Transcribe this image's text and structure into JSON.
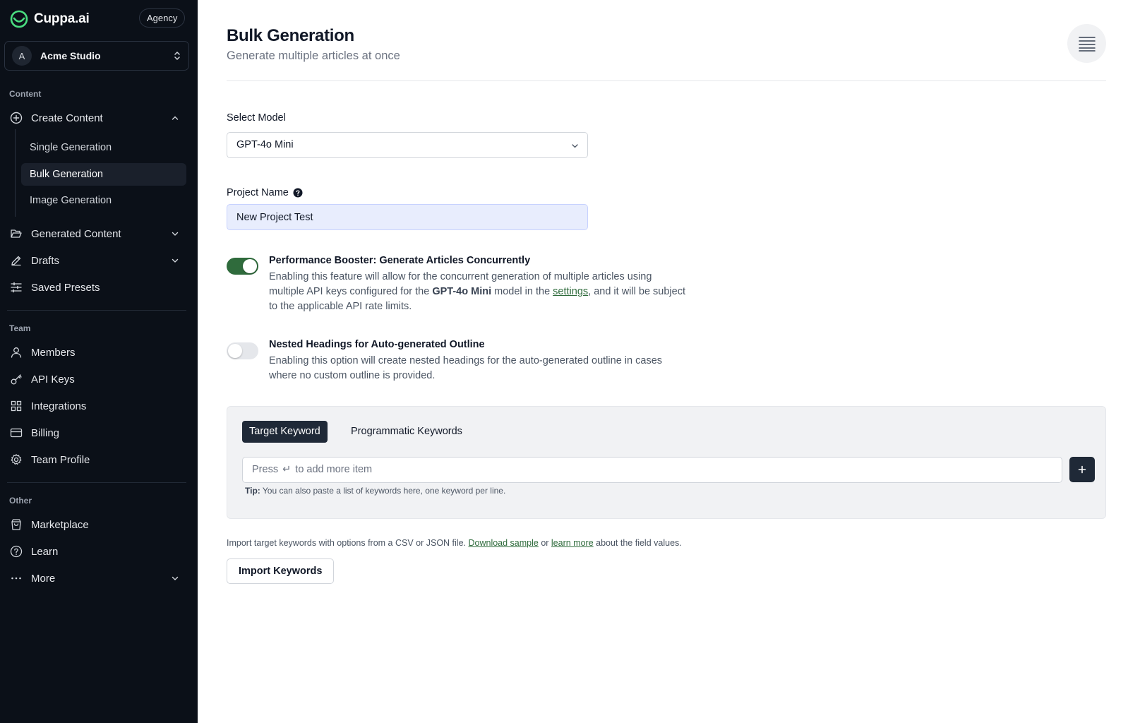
{
  "brand": {
    "name": "Cuppa.ai",
    "plan_badge": "Agency"
  },
  "team_switcher": {
    "avatar_initial": "A",
    "name": "Acme Studio"
  },
  "sidebar": {
    "content_section": "Content",
    "create_content": "Create Content",
    "sub_items": [
      "Single Generation",
      "Bulk Generation",
      "Image Generation"
    ],
    "active_sub_item": "Bulk Generation",
    "generated_content": "Generated Content",
    "drafts": "Drafts",
    "saved_presets": "Saved Presets",
    "team_section": "Team",
    "members": "Members",
    "api_keys": "API Keys",
    "integrations": "Integrations",
    "billing": "Billing",
    "team_profile": "Team Profile",
    "other_section": "Other",
    "marketplace": "Marketplace",
    "learn": "Learn",
    "more": "More"
  },
  "header": {
    "title": "Bulk Generation",
    "subtitle": "Generate multiple articles at once"
  },
  "form": {
    "model_label": "Select Model",
    "model_value": "GPT-4o Mini",
    "project_label": "Project Name",
    "project_value": "New Project Test"
  },
  "options": {
    "booster": {
      "enabled": true,
      "title": "Performance Booster: Generate Articles Concurrently",
      "desc_1": "Enabling this feature will allow for the concurrent generation of multiple articles using multiple API keys configured for the ",
      "desc_model": "GPT-4o Mini",
      "desc_2": " model in the ",
      "desc_link": "settings",
      "desc_3": ", and it will be subject to the applicable API rate limits."
    },
    "nested": {
      "enabled": false,
      "title": "Nested Headings for Auto-generated Outline",
      "desc": "Enabling this option will create nested headings for the auto-generated outline in cases where no custom outline is provided."
    }
  },
  "keywords": {
    "tab_active": "Target Keyword",
    "tab_inactive": "Programmatic Keywords",
    "input_prefix": "Press",
    "input_enter_glyph": "↵",
    "input_suffix": "to add more item",
    "tip_label": "Tip:",
    "tip_text": " You can also paste a list of keywords here, one keyword per line."
  },
  "import": {
    "note_1": "Import target keywords with options from a CSV or JSON file. ",
    "download_link": "Download sample",
    "note_or": " or ",
    "learn_link": "learn more",
    "note_2": " about the field values.",
    "button": "Import Keywords"
  },
  "colors": {
    "sidebar_bg": "#0b1018",
    "accent_green": "#2f6b3c",
    "brand_logo_green": "#4ade80",
    "dark_button": "#1f2937"
  }
}
